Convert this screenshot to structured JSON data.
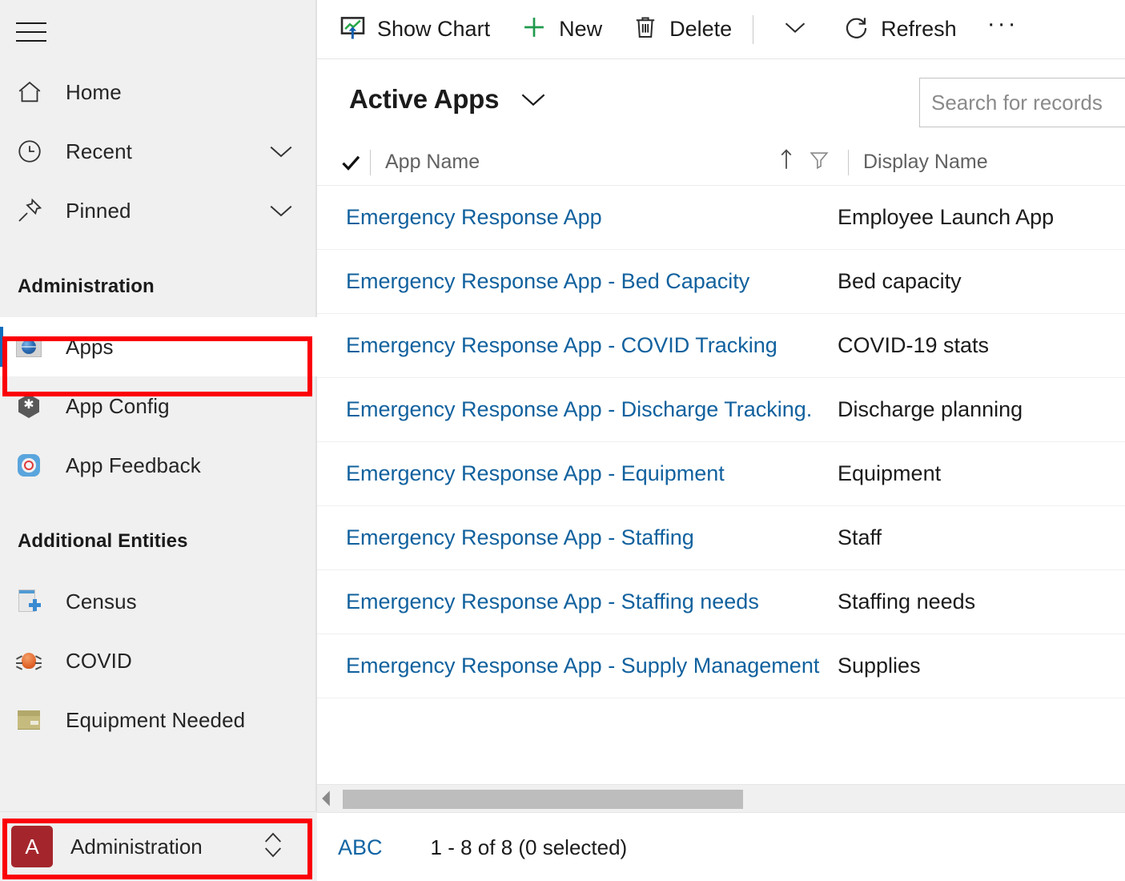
{
  "sidebar": {
    "hamburger_label": "Site Map",
    "nav": [
      {
        "label": "Home",
        "icon": "home-icon",
        "chevron": false
      },
      {
        "label": "Recent",
        "icon": "clock-icon",
        "chevron": true
      },
      {
        "label": "Pinned",
        "icon": "pin-icon",
        "chevron": true
      }
    ],
    "groups": [
      {
        "title": "Administration",
        "items": [
          {
            "label": "Apps",
            "icon": "globe-screen-icon",
            "selected": true
          },
          {
            "label": "App Config",
            "icon": "hexagon-gear-icon",
            "selected": false
          },
          {
            "label": "App Feedback",
            "icon": "life-preserver-icon",
            "selected": false
          }
        ]
      },
      {
        "title": "Additional Entities",
        "items": [
          {
            "label": "Census",
            "icon": "document-plus-icon",
            "selected": false
          },
          {
            "label": "COVID",
            "icon": "bug-icon",
            "selected": false
          },
          {
            "label": "Equipment Needed",
            "icon": "box-icon",
            "selected": false
          }
        ]
      }
    ],
    "area_switcher": {
      "avatar_letter": "A",
      "name": "Administration"
    }
  },
  "commandbar": {
    "show_chart": "Show Chart",
    "new": "New",
    "delete": "Delete",
    "refresh": "Refresh",
    "overflow": "···"
  },
  "view": {
    "title": "Active Apps"
  },
  "search": {
    "placeholder": "Search for records",
    "value": ""
  },
  "grid": {
    "columns": [
      {
        "label": "App Name"
      },
      {
        "label": "Display Name"
      }
    ],
    "rows": [
      {
        "app_name": "Emergency Response App",
        "display_name": "Employee Launch App"
      },
      {
        "app_name": "Emergency Response App - Bed Capacity",
        "display_name": "Bed capacity"
      },
      {
        "app_name": "Emergency Response App - COVID Tracking",
        "display_name": "COVID-19 stats"
      },
      {
        "app_name": "Emergency Response App - Discharge Tracking.",
        "display_name": "Discharge planning"
      },
      {
        "app_name": "Emergency Response App - Equipment",
        "display_name": "Equipment"
      },
      {
        "app_name": "Emergency Response App - Staffing",
        "display_name": "Staff"
      },
      {
        "app_name": "Emergency Response App - Staffing needs",
        "display_name": "Staffing needs"
      },
      {
        "app_name": "Emergency Response App - Supply Management",
        "display_name": "Supplies"
      }
    ]
  },
  "statusbar": {
    "alpha_filter": "ABC",
    "record_count": "1 - 8 of 8 (0 selected)"
  },
  "colors": {
    "accent_blue": "#0f6cbd",
    "link_blue": "#11619e",
    "avatar_red": "#a4262c",
    "annotation_red": "#fb0007",
    "sidebar_bg": "#f0f0f0"
  }
}
